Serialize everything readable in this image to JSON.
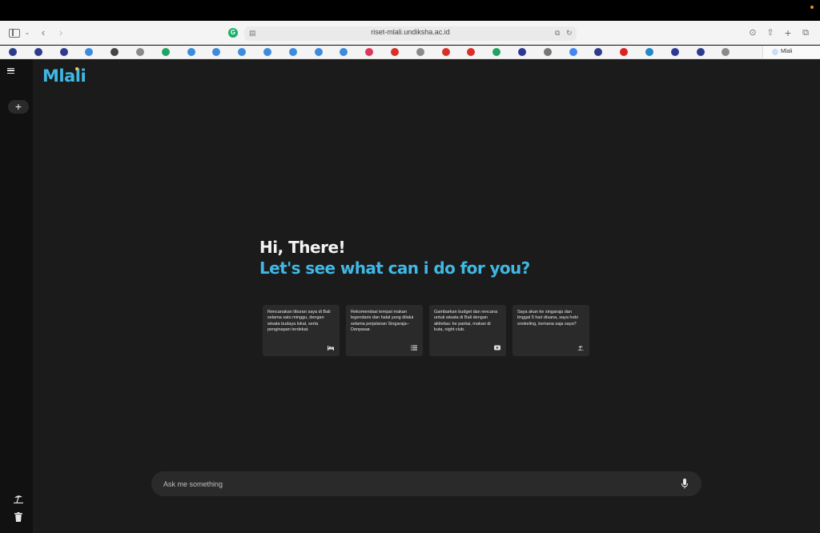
{
  "browser": {
    "url": "riset-mlali.undiksha.ac.id",
    "active_tab": "Mlali",
    "favorites": [
      {
        "icon": "university-icon",
        "color": "#2d3b8c"
      },
      {
        "icon": "university-icon",
        "color": "#2d3b8c"
      },
      {
        "icon": "university-icon",
        "color": "#2d3b8c"
      },
      {
        "icon": "diamond-icon",
        "color": "#3b8be0"
      },
      {
        "icon": "openai-icon",
        "color": "#444444"
      },
      {
        "icon": "g-box-icon",
        "color": "#8a8a8a"
      },
      {
        "icon": "google-drive-icon",
        "color": "#1fa463"
      },
      {
        "icon": "diamond-icon",
        "color": "#3b8be0"
      },
      {
        "icon": "diamond-icon",
        "color": "#3b8be0"
      },
      {
        "icon": "diamond-icon",
        "color": "#3b8be0"
      },
      {
        "icon": "diamond-icon",
        "color": "#3b8be0"
      },
      {
        "icon": "diamond-icon",
        "color": "#3b8be0"
      },
      {
        "icon": "diamond-icon",
        "color": "#3b8be0"
      },
      {
        "icon": "diamond-icon",
        "color": "#3b8be0"
      },
      {
        "icon": "heart-icon",
        "color": "#e0355a"
      },
      {
        "icon": "gmail-icon",
        "color": "#d93025"
      },
      {
        "icon": "g-box-icon",
        "color": "#8a8a8a"
      },
      {
        "icon": "gmail-icon",
        "color": "#d93025"
      },
      {
        "icon": "gmail-icon",
        "color": "#d93025"
      },
      {
        "icon": "google-drive-icon",
        "color": "#1fa463"
      },
      {
        "icon": "arrow-icon",
        "color": "#2b3a99"
      },
      {
        "icon": "star-icon",
        "color": "#777777"
      },
      {
        "icon": "google-icon",
        "color": "#4285f4"
      },
      {
        "icon": "university-icon",
        "color": "#2d3b8c"
      },
      {
        "icon": "youtube-icon",
        "color": "#e02020"
      },
      {
        "icon": "globe-icon",
        "color": "#1e88c8"
      },
      {
        "icon": "arrow-icon",
        "color": "#2b3a99"
      },
      {
        "icon": "university-icon",
        "color": "#2d3b8c"
      },
      {
        "icon": "z-box-icon",
        "color": "#8a8a8a"
      }
    ]
  },
  "app": {
    "logo": "Mlali",
    "greeting_line1": "Hi, There!",
    "greeting_line2": "Let's see what can i do for you?",
    "suggestions": [
      {
        "text": "Rencanakan liburan saya di Bali selama satu minggu, dengan wisata budaya lokal, serta penginapan terdekat.",
        "icon": "bed-icon"
      },
      {
        "text": "Rekomendasi tempat makan legendaris dan halal yang dilalui selama perjalanan Singaraja–Denpasar.",
        "icon": "list-icon"
      },
      {
        "text": "Gambarkan budget dan rencana untuk wisata di Bali dengan aktivitas: ke pantai, makan di kuta, night club.",
        "icon": "youtube-icon"
      },
      {
        "text": "Saya akan ke singaraja dan tinggal 5 hari disana, saya hobi snokeling, kemana saja saya?",
        "icon": "beach-icon"
      }
    ],
    "ask_placeholder": "Ask me something",
    "colors": {
      "accent": "#3fb8e4",
      "background": "#1b1b1b",
      "sidebar": "#111111",
      "card": "#2a2a2a"
    }
  }
}
